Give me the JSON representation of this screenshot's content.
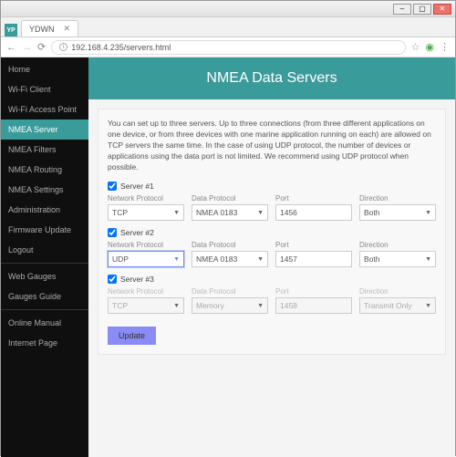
{
  "browser": {
    "tab_title": "YDWN",
    "url": "192.168.4.235/servers.html"
  },
  "sidebar": {
    "items": [
      {
        "label": "Home",
        "active": false
      },
      {
        "label": "Wi-Fi Client",
        "active": false
      },
      {
        "label": "Wi-Fi Access Point",
        "active": false
      },
      {
        "label": "NMEA Server",
        "active": true
      },
      {
        "label": "NMEA Filters",
        "active": false
      },
      {
        "label": "NMEA Routing",
        "active": false
      },
      {
        "label": "NMEA Settings",
        "active": false
      },
      {
        "label": "Administration",
        "active": false
      },
      {
        "label": "Firmware Update",
        "active": false
      },
      {
        "label": "Logout",
        "active": false
      }
    ],
    "group2": [
      {
        "label": "Web Gauges"
      },
      {
        "label": "Gauges Guide"
      }
    ],
    "group3": [
      {
        "label": "Online Manual"
      },
      {
        "label": "Internet Page"
      }
    ]
  },
  "page": {
    "title": "NMEA Data Servers",
    "intro": "You can set up to three servers. Up to three connections (from three different applications on one device, or from three devices with one marine application running on each) are allowed on TCP servers the same time. In the case of using UDP protocol, the number of devices or applications using the data port is not limited. We recommend using UDP protocol when possible.",
    "labels": {
      "network_protocol": "Network Protocol",
      "data_protocol": "Data Protocol",
      "port": "Port",
      "direction": "Direction"
    },
    "servers": [
      {
        "title": "Server #1",
        "checked": true,
        "network_protocol": "TCP",
        "data_protocol": "NMEA 0183",
        "port": "1456",
        "direction": "Both",
        "disabled": false,
        "open": false
      },
      {
        "title": "Server #2",
        "checked": true,
        "network_protocol": "UDP",
        "data_protocol": "NMEA 0183",
        "port": "1457",
        "direction": "Both",
        "disabled": false,
        "open": true
      },
      {
        "title": "Server #3",
        "checked": true,
        "network_protocol": "TCP",
        "data_protocol": "Memory",
        "port": "1458",
        "direction": "Transmit Only",
        "disabled": true,
        "open": false
      }
    ],
    "update_button": "Update"
  }
}
